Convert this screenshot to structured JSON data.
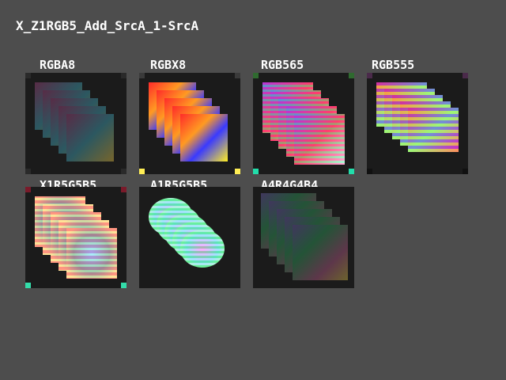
{
  "title": "X_Z1RGB5_Add_SrcA_1-SrcA",
  "colors": {
    "background": "#4d4d4d",
    "tile": "#1b1b1b",
    "text": "#ffffff"
  },
  "formats": [
    {
      "label": "RGBA8",
      "corners": [
        "#2a2a2a",
        "#2a2a2a",
        "#2a2a2a",
        "#2a2a2a"
      ]
    },
    {
      "label": "RGBX8",
      "corners": [
        "#3a3a3a",
        "#3a3a3a",
        "#ffee55",
        "#ffee55"
      ]
    },
    {
      "label": "RGB565",
      "corners": [
        "#2f6a2f",
        "#2f6a2f",
        "#22ddaa",
        "#22ddaa"
      ]
    },
    {
      "label": "RGB555",
      "corners": [
        "#4a2a4a",
        "#4a2a4a",
        "#111111",
        "#111111"
      ]
    },
    {
      "label": "X1R5G5B5",
      "corners": [
        "#7a1a2a",
        "#7a1a2a",
        "#33ddaa",
        "#33ddaa"
      ]
    },
    {
      "label": "A1R5G5B5",
      "corners": [
        "#1b1b1b",
        "#1b1b1b",
        "#1b1b1b",
        "#1b1b1b"
      ]
    },
    {
      "label": "A4R4G4B4",
      "corners": [
        "#1b1b1b",
        "#1b1b1b",
        "#1b1b1b",
        "#1b1b1b"
      ]
    }
  ]
}
